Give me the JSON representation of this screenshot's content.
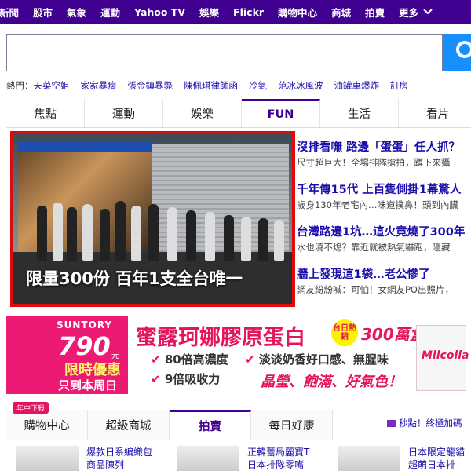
{
  "topnav": {
    "items": [
      "新聞",
      "股市",
      "氣象",
      "運動",
      "Yahoo TV",
      "娛樂",
      "Flickr",
      "購物中心",
      "商城",
      "拍賣"
    ],
    "more_label": "更多"
  },
  "search": {
    "placeholder": ""
  },
  "trending": {
    "label": "熱門：",
    "items": [
      "天菜空姐",
      "家家暴瘦",
      "張金鎮暴斃",
      "陳佩琪律師函",
      "冷氣",
      "范冰冰風波",
      "油罐車爆炸",
      "訂房"
    ]
  },
  "tabs": [
    "焦點",
    "運動",
    "娛樂",
    "FUN",
    "生活",
    "看片"
  ],
  "active_tab": "FUN",
  "feature": {
    "caption": "限量300份 百年1支全台唯一"
  },
  "stories": [
    {
      "title": "沒排看嘸 路邊「蛋蛋」任人抓？",
      "snippet": "尺寸超巨大！全場排隊搶拍，蹲下來攝"
    },
    {
      "title": "千年傳15代 上百隻側掛1幕驚人",
      "snippet": "歲身130年老宅內…味道撲鼻！頭到內臟"
    },
    {
      "title": "台灣路邊1坑…這火竟燒了300年",
      "snippet": "水也澆不熄？靠近就被熱氣嚇跑，隱藏"
    },
    {
      "title": "牆上發現這1袋…老公慘了",
      "snippet": "網友紛紛喊：可怕！女網友PO出照片，"
    }
  ],
  "banner": {
    "brand": "SUNTORY",
    "price": "790",
    "unit": "元",
    "sale": "限時優惠",
    "until": "只到本周日",
    "title": "蜜露珂娜膠原蛋白",
    "hot": "台日熱銷",
    "sold": "300萬盒",
    "feature1": "80倍高濃度",
    "feature2": "淡淡奶香好口感、無腥味",
    "feature3": "9倍吸收力",
    "slogan": "晶瑩、飽滿、好氣色！",
    "product": "Milcolla"
  },
  "shop": {
    "badge": "年中下殺",
    "tabs": [
      "購物中心",
      "超級商城",
      "拍賣",
      "每日好康"
    ],
    "active_tab": "拍賣",
    "promo": "秒點！終極加碼",
    "products": [
      {
        "line1": "爆款日系編織包",
        "line2": "商品陳列"
      },
      {
        "line1": "正韓蕾局麗寶T",
        "line2": "日本排隊零嘴"
      },
      {
        "line1": "日本限定龍貓",
        "line2": "超萌日本排"
      }
    ]
  },
  "colors": {
    "brand_purple": "#400090",
    "search_blue": "#188fff",
    "highlight_red": "#e10a0a",
    "banner_pink": "#ec1a72"
  }
}
